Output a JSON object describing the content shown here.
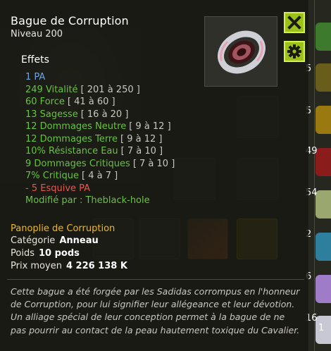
{
  "tooltip": {
    "title": "Bague de Corruption",
    "level_label": "Niveau",
    "level_value": "200",
    "effects_heading": "Effets",
    "effects": [
      {
        "main": "1 PA",
        "range": "",
        "color": "blue"
      },
      {
        "main": "249 Vitalité",
        "range": "[ 201 à 250 ]",
        "color": "green"
      },
      {
        "main": "60 Force",
        "range": "[ 41 à 60 ]",
        "color": "green"
      },
      {
        "main": "13 Sagesse",
        "range": "[ 16 à 20 ]",
        "color": "green"
      },
      {
        "main": "12 Dommages Neutre",
        "range": "[ 9 à 12 ]",
        "color": "green"
      },
      {
        "main": "12 Dommages Terre",
        "range": "[ 9 à 12 ]",
        "color": "green"
      },
      {
        "main": "10% Résistance Eau",
        "range": "[ 7 à 10 ]",
        "color": "green"
      },
      {
        "main": "9 Dommages Critiques",
        "range": "[ 7 à 10 ]",
        "color": "green"
      },
      {
        "main": "7% Critique",
        "range": "[ 4 à 7 ]",
        "color": "green"
      },
      {
        "main": "- 5 Esquive PA",
        "range": "",
        "color": "red"
      }
    ],
    "modified_by_label": "Modifié par :",
    "modified_by_name": "Theblack-hole",
    "set_name": "Panoplie de Corruption",
    "category_label": "Catégorie",
    "category_value": "Anneau",
    "weight_label": "Poids",
    "weight_value": "10 pods",
    "price_label": "Prix moyen",
    "price_value": "4 226 138 K",
    "description": "Cette bague a été forgée par les Sadidas corrompus en l'honneur de Corruption, pour lui signifier leur allégeance et leur dévotion. Un alliage spécial de leur conception permet à la bague de ne pas pourrir au contact de la peau hautement toxique du Cavalier."
  },
  "buttons": {
    "close_icon": "close-icon",
    "settings_icon": "gear-icon"
  },
  "side_counts": [
    "5",
    "5",
    "49",
    "54",
    "2",
    "6",
    "16",
    "1"
  ],
  "colors": {
    "accent_button": "#9bc11a",
    "effect_blue": "#6fa4e0",
    "effect_green": "#67c340",
    "effect_red": "#e15a52",
    "set_gold": "#f0b81f"
  }
}
